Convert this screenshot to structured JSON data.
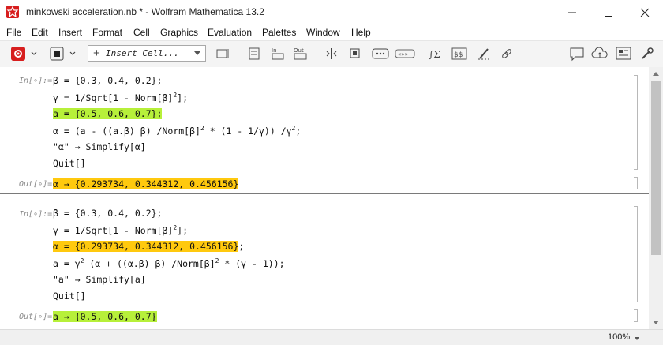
{
  "window": {
    "title": "minkowski acceleration.nb * - Wolfram Mathematica 13.2"
  },
  "menu": [
    "File",
    "Edit",
    "Insert",
    "Format",
    "Cell",
    "Graphics",
    "Evaluation",
    "Palettes",
    "Window",
    "Help"
  ],
  "toolbar": {
    "insert_cell_label": "Insert Cell..."
  },
  "cell1": {
    "in_label": "In[∘]:=",
    "out_label": "Out[∘]=",
    "line1": "β = {0.3, 0.4, 0.2};",
    "line2_prefix": "γ = 1/Sqrt[1 - Norm[β]",
    "line2_exp": "2",
    "line2_suffix": "];",
    "line3": "a = {0.5, 0.6, 0.7};",
    "line4_prefix": "α = (a - ((a.β) β) /Norm[β]",
    "line4_exp1": "2",
    "line4_mid": " * (1 - 1/γ)) /γ",
    "line4_exp2": "2",
    "line4_suffix": ";",
    "line5": "\"α\" → Simplify[α]",
    "line6": "Quit[]",
    "output": "α → {0.293734, 0.344312, 0.456156}"
  },
  "cell2": {
    "in_label": "In[∘]:=",
    "out_label": "Out[∘]=",
    "line1": "β = {0.3, 0.4, 0.2};",
    "line2_prefix": "γ = 1/Sqrt[1 - Norm[β]",
    "line2_exp": "2",
    "line2_suffix": "];",
    "line3_hl": "α = {0.293734, 0.344312, 0.456156}",
    "line3_suffix": ";",
    "line4_prefix": "a = γ",
    "line4_exp1": "2",
    "line4_mid": " (α + ((α.β) β) /Norm[β]",
    "line4_exp2": "2",
    "line4_suffix": " * (γ - 1));",
    "line5": "\"a\" → Simplify[a]",
    "line6": "Quit[]",
    "output": "a → {0.5, 0.6, 0.7}"
  },
  "status": {
    "zoom": "100%"
  },
  "colors": {
    "green_highlight": "#b7f03a",
    "yellow_highlight": "#ffc90e",
    "app_red": "#d71e1e"
  }
}
